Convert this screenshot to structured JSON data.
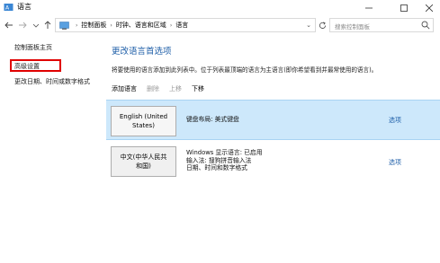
{
  "window": {
    "title": "语言"
  },
  "addressbar": {
    "crumbs": [
      "控制面板",
      "时钟、语言和区域",
      "语言"
    ],
    "search_placeholder": "搜索控制面板"
  },
  "sidebar": {
    "items": [
      {
        "label": "控制面板主页"
      },
      {
        "label": "高级设置"
      },
      {
        "label": "更改日期、时间或数字格式"
      }
    ]
  },
  "main": {
    "heading": "更改语言首选项",
    "description": "将要使用的语言添加到此列表中。位于列表最顶端的语言为主语言(即你希望看到并最常使用的语言)。",
    "toolbar": {
      "add": "添加语言",
      "remove": "删除",
      "up": "上移",
      "down": "下移"
    },
    "languages": [
      {
        "name_line1": "English (United",
        "name_line2": "States)",
        "details": [
          "键盘布局: 美式键盘"
        ],
        "options": "选项"
      },
      {
        "name_line1": "中文(中华人民共",
        "name_line2": "和国)",
        "details": [
          "Windows 显示语言: 已启用",
          "输入法: 搜狗拼音输入法",
          "日期、时间和数字格式"
        ],
        "options": "选项"
      }
    ]
  },
  "colors": {
    "accent_link": "#1f5fa8",
    "selected_row": "#cde8fb",
    "highlight_box": "#e00000"
  }
}
